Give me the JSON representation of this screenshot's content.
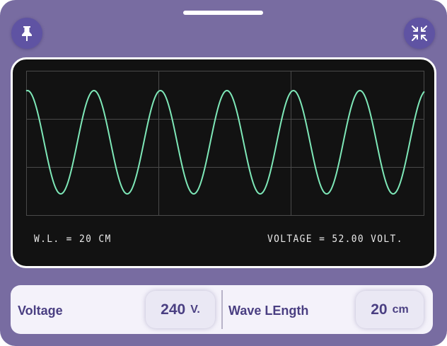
{
  "toolbar": {
    "pin_icon": "pin-icon",
    "collapse_icon": "collapse-arrows-icon"
  },
  "oscilloscope": {
    "wavelength_readout": "W.L. = 20 CM",
    "voltage_readout": "VOLTAGE = 52.00 VOLT.",
    "trace_color": "#7ee8b8",
    "screen_color": "#121212",
    "cycles_shown": 6
  },
  "controls": {
    "voltage": {
      "label": "Voltage",
      "value": "240",
      "unit": "V."
    },
    "wavelength": {
      "label": "Wave LEngth",
      "value": "20",
      "unit": "cm"
    }
  },
  "colors": {
    "background": "#786ca1",
    "button": "#5f53a3",
    "accent_text": "#4a3f82"
  }
}
